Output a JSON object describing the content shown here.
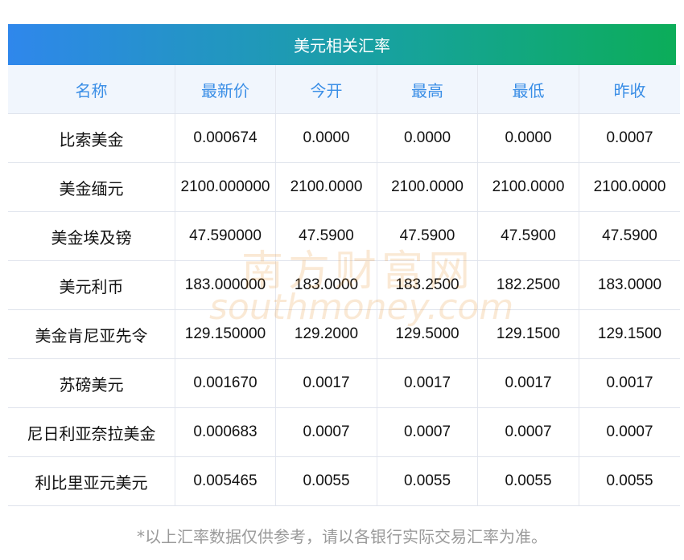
{
  "title": "美元相关汇率",
  "headers": [
    "名称",
    "最新价",
    "今开",
    "最高",
    "最低",
    "昨收"
  ],
  "rows": [
    [
      "比索美金",
      "0.000674",
      "0.0000",
      "0.0000",
      "0.0000",
      "0.0007"
    ],
    [
      "美金缅元",
      "2100.000000",
      "2100.0000",
      "2100.0000",
      "2100.0000",
      "2100.0000"
    ],
    [
      "美金埃及镑",
      "47.590000",
      "47.5900",
      "47.5900",
      "47.5900",
      "47.5900"
    ],
    [
      "美元利币",
      "183.000000",
      "183.0000",
      "183.2500",
      "182.2500",
      "183.0000"
    ],
    [
      "美金肯尼亚先令",
      "129.150000",
      "129.2000",
      "129.5000",
      "129.1500",
      "129.1500"
    ],
    [
      "苏磅美元",
      "0.001670",
      "0.0017",
      "0.0017",
      "0.0017",
      "0.0017"
    ],
    [
      "尼日利亚奈拉美金",
      "0.000683",
      "0.0007",
      "0.0007",
      "0.0007",
      "0.0007"
    ],
    [
      "利比里亚元美元",
      "0.005465",
      "0.0055",
      "0.0055",
      "0.0055",
      "0.0055"
    ]
  ],
  "footnote": "*以上汇率数据仅供参考，请以各银行实际交易汇率为准。",
  "watermark": {
    "cn": "南方财富网",
    "en": "southmoney.com"
  }
}
